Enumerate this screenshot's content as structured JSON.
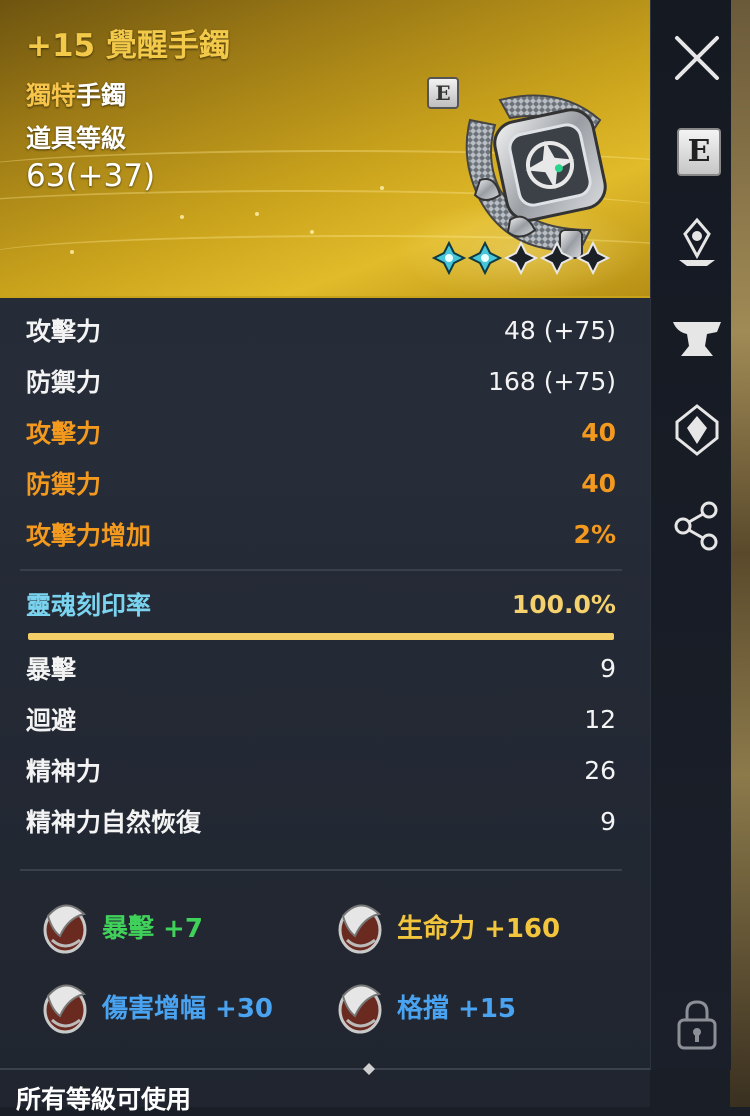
{
  "item": {
    "title": "+15 覺醒手鐲",
    "grade": "獨特",
    "type": "手鐲",
    "level_label": "道具等級",
    "level_value": "63(+37)",
    "badge": "E",
    "stars_filled": 2,
    "stars_total": 5
  },
  "stats": [
    {
      "label": "攻擊力",
      "value": "48 (+75)",
      "color": "white"
    },
    {
      "label": "防禦力",
      "value": "168 (+75)",
      "color": "white"
    },
    {
      "label": "攻擊力",
      "value": "40",
      "color": "orange"
    },
    {
      "label": "防禦力",
      "value": "40",
      "color": "orange"
    },
    {
      "label": "攻擊力增加",
      "value": "2%",
      "color": "orange"
    }
  ],
  "soul": {
    "label": "靈魂刻印率",
    "value": "100.0%",
    "fill": 1.0
  },
  "substats": [
    {
      "label": "暴擊",
      "value": "9"
    },
    {
      "label": "迴避",
      "value": "12"
    },
    {
      "label": "精神力",
      "value": "26"
    },
    {
      "label": "精神力自然恢復",
      "value": "9"
    }
  ],
  "engravings": [
    {
      "text": "暴擊 +7",
      "color": "green"
    },
    {
      "text": "生命力 +160",
      "color": "yellow"
    },
    {
      "text": "傷害增幅 +30",
      "color": "blue"
    },
    {
      "text": "格擋 +15",
      "color": "blue"
    }
  ],
  "footer": {
    "usable_text": "所有等級可使用"
  },
  "sidebar": {
    "icons": [
      "close-icon",
      "equip-icon",
      "enhance-icon",
      "anvil-icon",
      "soul-crystal-icon",
      "share-icon",
      "lock-icon"
    ],
    "equip_badge": "E"
  },
  "colors": {
    "orange": "#f39a1e",
    "cyan": "#7bd4ef",
    "gold": "#f4cf67",
    "green": "#40d15a",
    "yellow": "#f2c53c",
    "blue": "#4aa3f0"
  }
}
